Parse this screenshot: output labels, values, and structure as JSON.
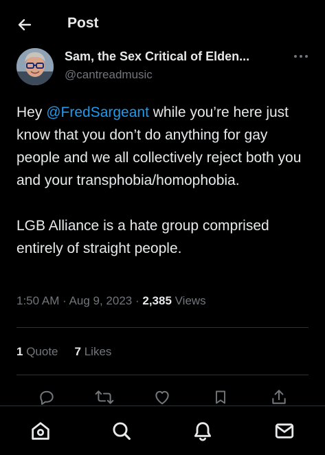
{
  "header": {
    "title": "Post",
    "back_icon": "arrow-left-icon"
  },
  "author": {
    "name": "Sam, the Sex Critical of Elden...",
    "handle": "@cantreadmusic",
    "avatar_icon": "user-avatar"
  },
  "post": {
    "para1_pre": "Hey ",
    "mention": "@FredSargeant",
    "para1_post": " while you’re here just know that you don’t do anything for gay people and we all collectively reject both you and your transphobia/homophobia.",
    "para2": "LGB Alliance is a hate group comprised entirely of straight people."
  },
  "meta": {
    "time": "1:50 AM",
    "sep1": " · ",
    "date": "Aug 9, 2023",
    "sep2": " · ",
    "views_count": "2,385",
    "views_label": " Views"
  },
  "stats": {
    "quotes_count": "1",
    "quotes_label": " Quote",
    "likes_count": "7",
    "likes_label": " Likes"
  },
  "actions": [
    "reply-icon",
    "repost-icon",
    "like-icon",
    "bookmark-icon",
    "share-icon"
  ],
  "nav": [
    "home-icon",
    "search-icon",
    "notifications-icon",
    "messages-icon"
  ],
  "colors": {
    "background": "#000000",
    "text": "#e7e9ea",
    "secondary": "#71767b",
    "accent": "#1d9bf0",
    "divider": "#2f3336"
  }
}
